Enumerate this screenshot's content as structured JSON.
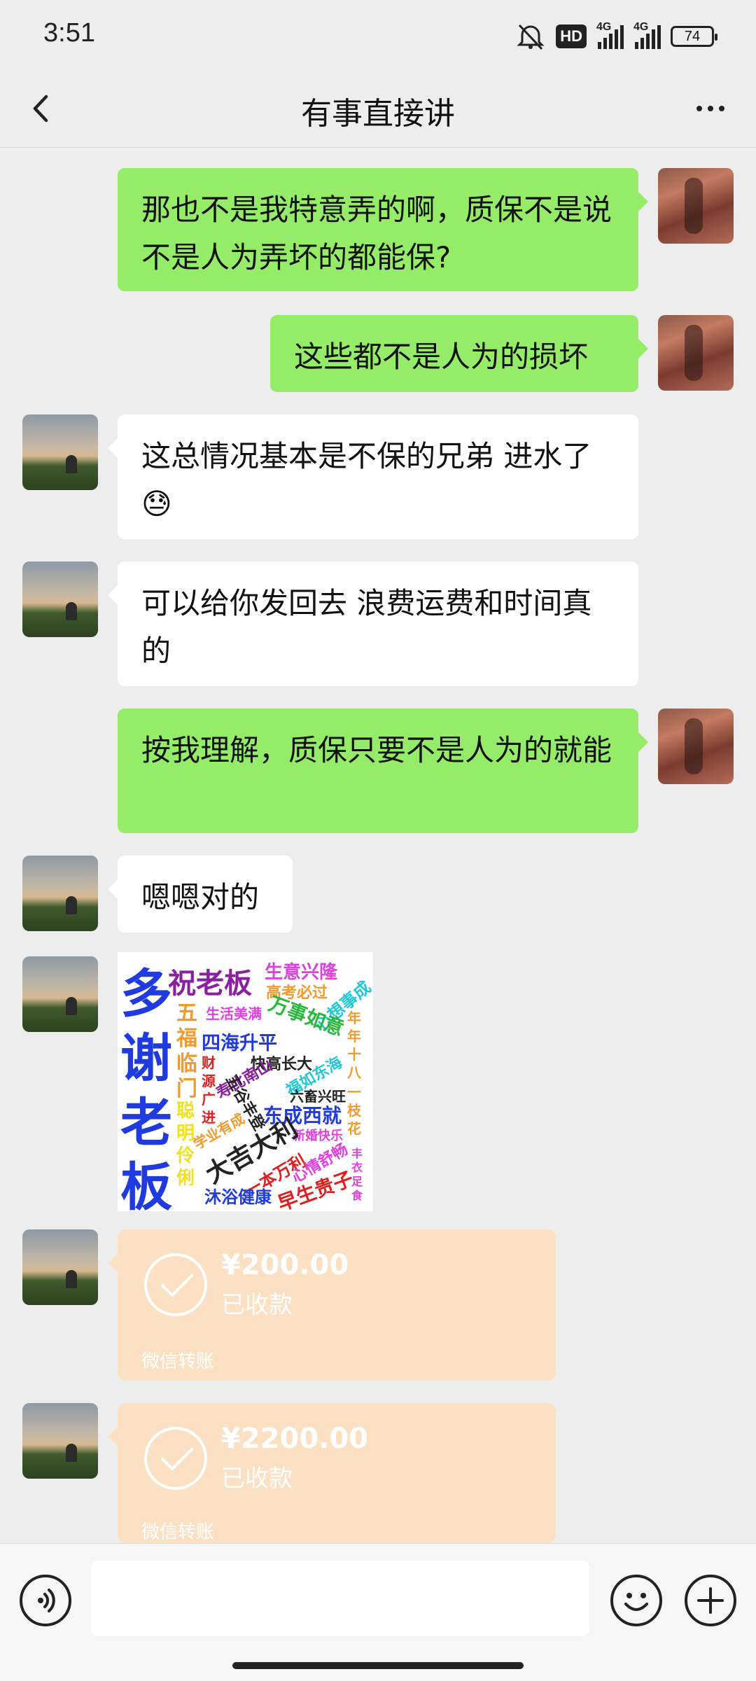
{
  "status_bar": {
    "time": "3:51",
    "hd_label": "HD",
    "network_1": "4G",
    "network_2": "4G",
    "battery": "74",
    "icons": [
      "mute-icon",
      "hd-icon",
      "signal-icon",
      "signal-icon",
      "battery-icon"
    ]
  },
  "nav": {
    "title": "有事直接讲",
    "back_icon": "chevron-left-icon",
    "more_icon": "more-dots-icon"
  },
  "messages": [
    {
      "from": "me",
      "text": "那也不是我特意弄的啊，质保不是说不是人为弄坏的都能保?"
    },
    {
      "from": "me",
      "text": "这些都不是人为的损坏"
    },
    {
      "from": "peer",
      "text": "这总情况基本是不保的兄弟 进水了😓"
    },
    {
      "from": "peer",
      "text": "可以给你发回去 浪费运费和时间真的"
    },
    {
      "from": "me",
      "text": "按我理解，质保只要不是人为的就能"
    },
    {
      "from": "peer",
      "text": "嗯嗯对的"
    }
  ],
  "sticker": {
    "words": [
      "多",
      "谢",
      "老",
      "板",
      "祝老板",
      "生意兴隆",
      "高考必过",
      "心想事成",
      "五",
      "福",
      "临",
      "门",
      "生活美满",
      "万事如意",
      "年",
      "年",
      "十",
      "八",
      "四海升平",
      "快高长大",
      "寿比南山",
      "福如东海",
      "财",
      "源",
      "广",
      "进",
      "五谷丰登",
      "六畜兴旺",
      "一",
      "枝",
      "花",
      "聪",
      "明",
      "伶",
      "俐",
      "学业有成",
      "东成西就",
      "新婚快乐",
      "大吉大利",
      "一本万利",
      "心情舒畅",
      "丰",
      "衣",
      "足",
      "食",
      "沐浴健康",
      "早生贵子"
    ],
    "colors": {
      "blue": "#1f3be0",
      "purple": "#8a1fa0",
      "magenta": "#e040e0",
      "orange": "#f29a2e",
      "green": "#2ab83c",
      "cyan": "#22c7d8",
      "red": "#e02020",
      "dark": "#222222"
    }
  },
  "transfers": [
    {
      "amount": "¥200.00",
      "status": "已收款",
      "label": "微信转账"
    },
    {
      "amount": "¥2200.00",
      "status": "已收款",
      "label": "微信转账"
    }
  ],
  "input_bar": {
    "voice_icon": "voice-icon",
    "emoji_icon": "emoji-icon",
    "plus_icon": "plus-icon",
    "placeholder": ""
  },
  "colors": {
    "my_bubble": "#95ec69",
    "peer_bubble": "#ffffff",
    "transfer_card": "#fbe0c4",
    "background": "#ededed"
  }
}
